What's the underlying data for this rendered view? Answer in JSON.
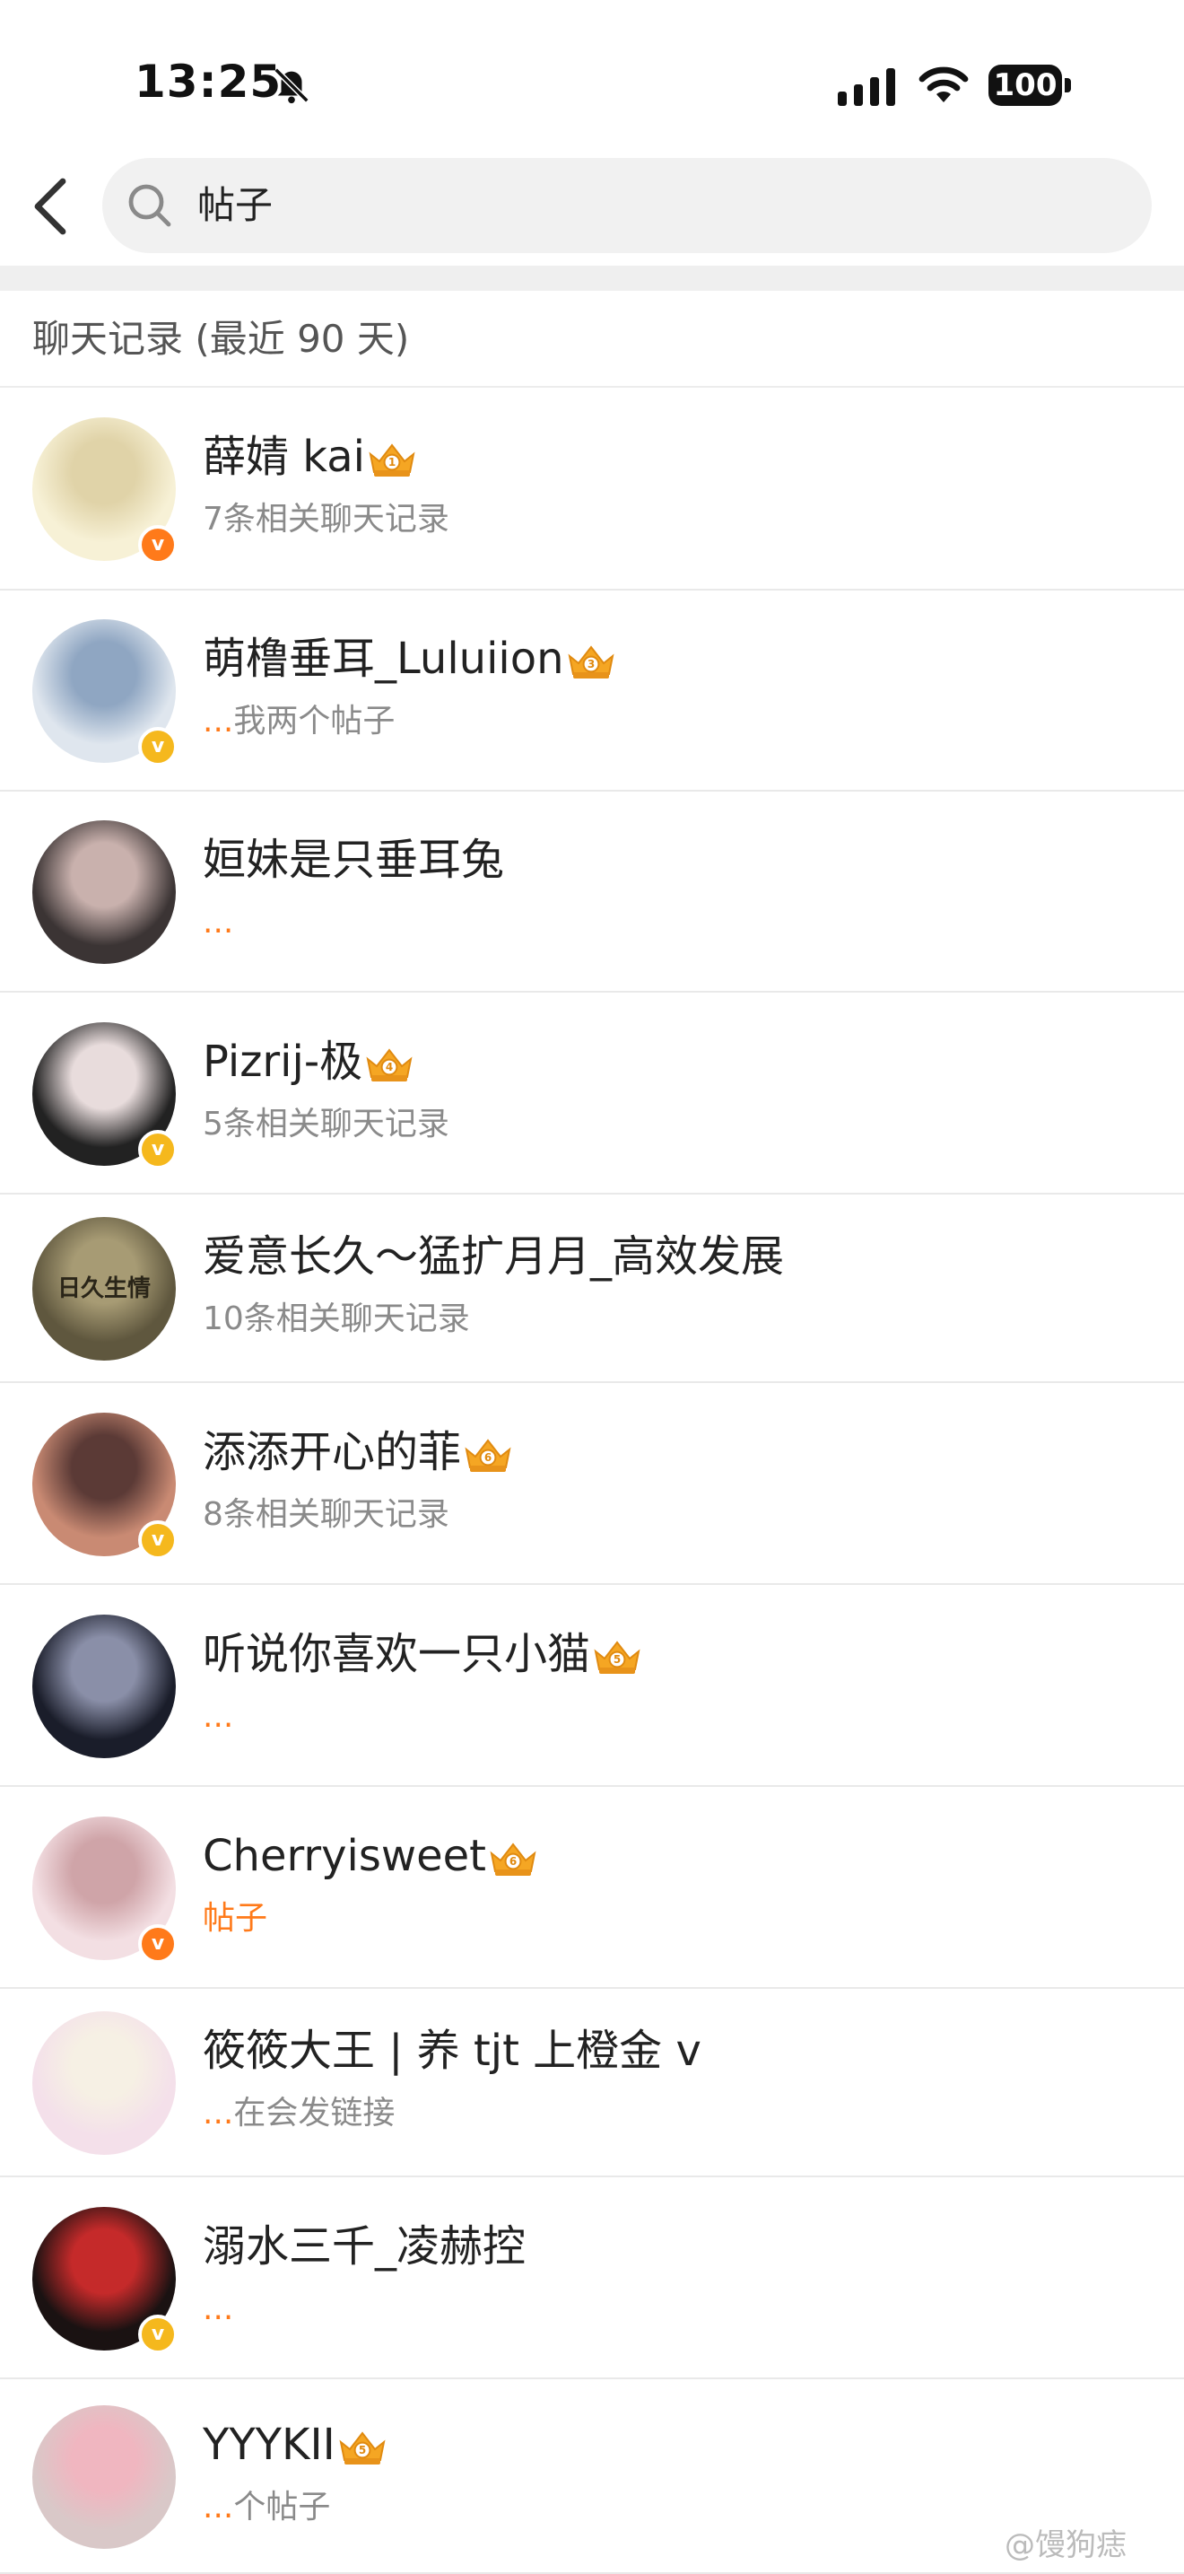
{
  "status_bar": {
    "time": "13:25",
    "battery": "100"
  },
  "search": {
    "query": "帖子"
  },
  "section_title": "聊天记录 (最近 90 天)",
  "rows": [
    {
      "name": "薛婧 kai",
      "sub": "7条相关聊天记录",
      "crown_level": "1",
      "badge": "v",
      "avatar_colors": [
        "#f7f1d6",
        "#e0d3a8"
      ]
    },
    {
      "name": "萌橹垂耳_Luluiion",
      "sub": "...我两个帖子",
      "crown_level": "3",
      "badge": "v",
      "avatar_colors": [
        "#dfe6ee",
        "#8fa6c2"
      ]
    },
    {
      "name": "姮妹是只垂耳兔",
      "sub": "...",
      "avatar_colors": [
        "#3b3434",
        "#c9b1ad"
      ]
    },
    {
      "name": "Pizrij-极",
      "sub": "5条相关聊天记录",
      "crown_level": "4",
      "badge": "v",
      "avatar_colors": [
        "#222222",
        "#e8dcdc"
      ]
    },
    {
      "name": "爱意长久～猛扩月月_高效发展",
      "sub": "10条相关聊天记录",
      "avatar_colors": [
        "#5f573e",
        "#a79b74"
      ],
      "avatar_text": "日久生情"
    },
    {
      "name": "添添开心的菲",
      "sub": "8条相关聊天记录",
      "crown_level": "6",
      "badge": "v",
      "avatar_colors": [
        "#c98a73",
        "#5b3a36"
      ]
    },
    {
      "name": "听说你喜欢一只小猫",
      "sub": "...",
      "crown_level": "5",
      "avatar_colors": [
        "#1a1d2a",
        "#8a8fa8"
      ]
    },
    {
      "name": "Cherryisweet",
      "sub": "帖子",
      "sub_accent": true,
      "crown_level": "6",
      "badge": "v",
      "avatar_colors": [
        "#f3dfe3",
        "#cfa4a8"
      ]
    },
    {
      "name": "筱筱大王 | 养 tjt 上橙金 v",
      "sub": "...在会发链接",
      "avatar_colors": [
        "#f4e0ea",
        "#f6f0e4"
      ]
    },
    {
      "name": "溺水三千_凌赫控",
      "sub": "...",
      "badge": "v",
      "avatar_colors": [
        "#1a1212",
        "#c52a2a"
      ]
    },
    {
      "name": "YYYKII",
      "sub": "...个帖子",
      "crown_level": "5",
      "avatar_colors": [
        "#d9c8c8",
        "#f0b6c0"
      ]
    }
  ],
  "watermark": "@馒狗痣"
}
